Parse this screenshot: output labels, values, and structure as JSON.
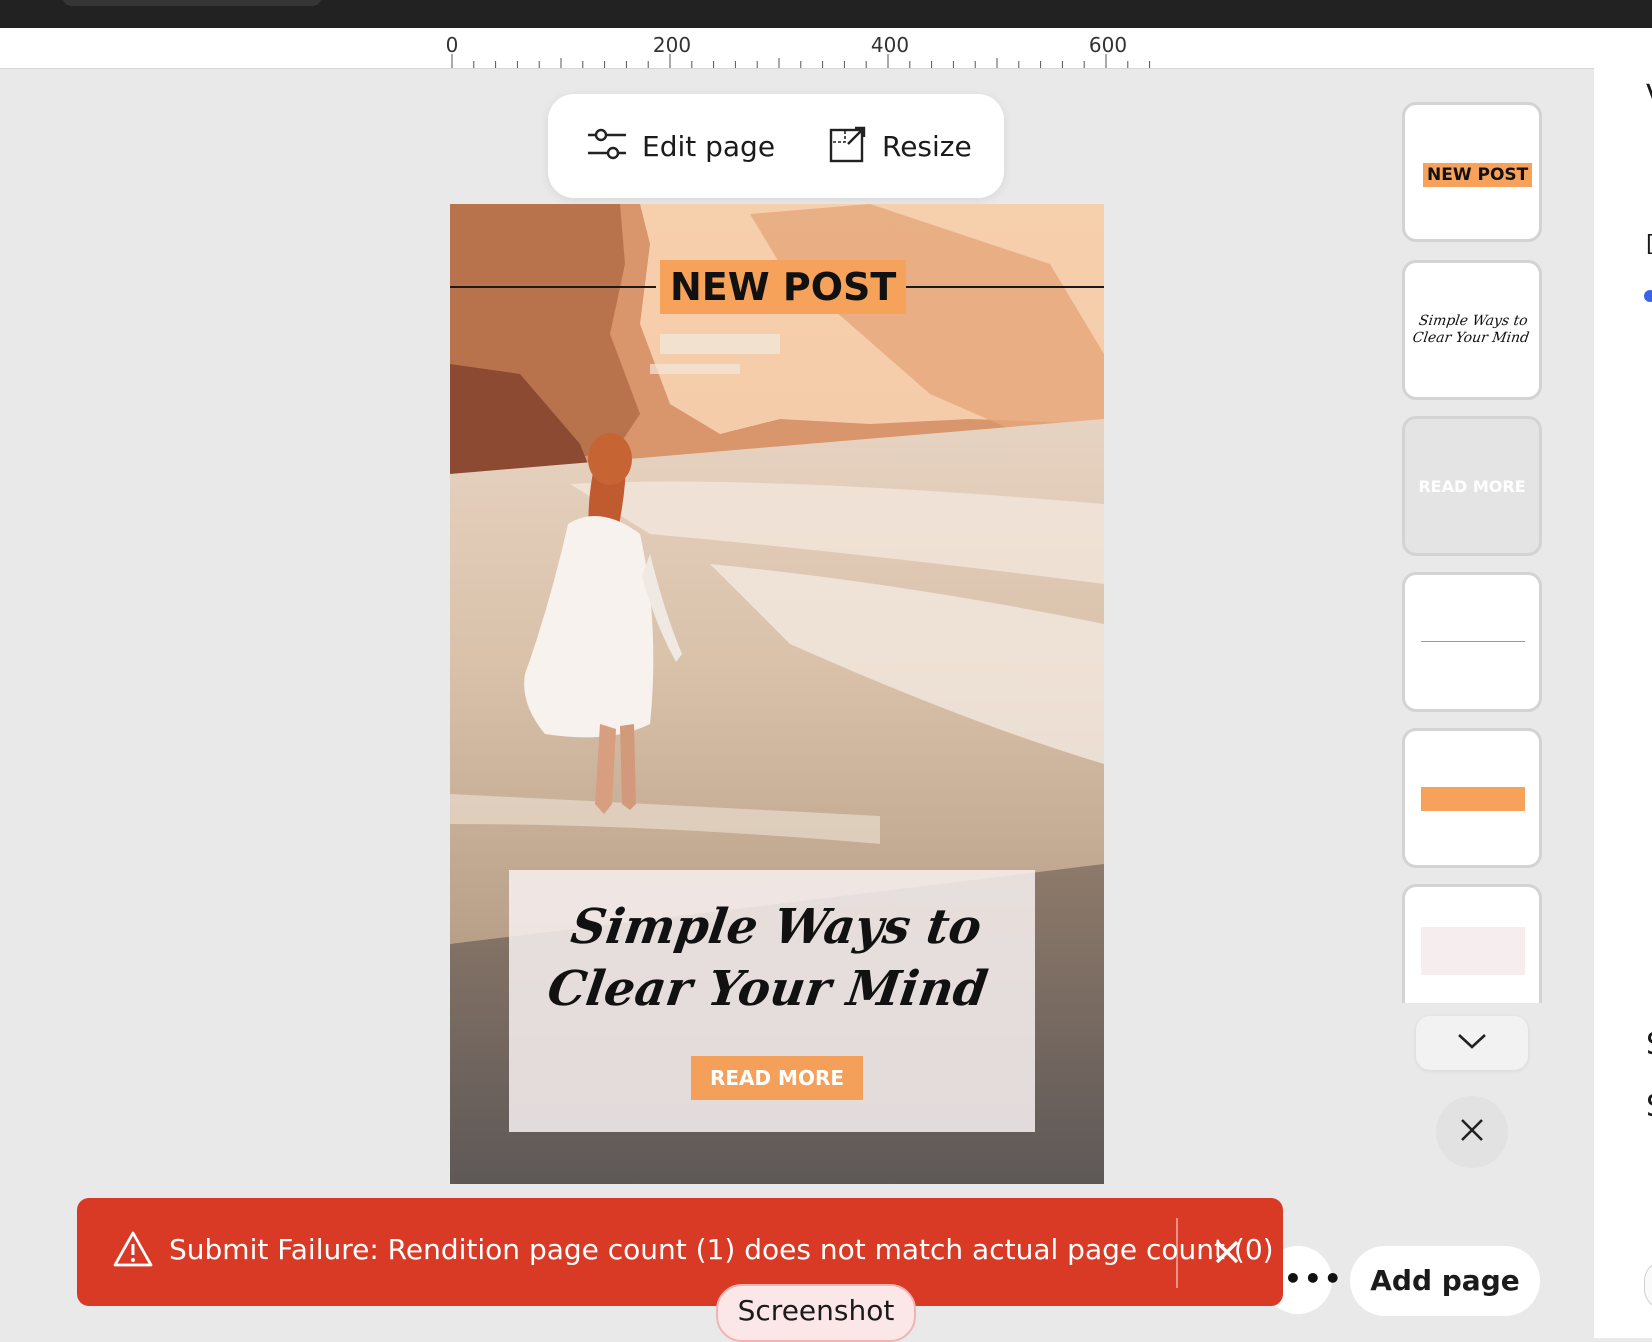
{
  "ruler": {
    "ticks": [
      "0",
      "200",
      "400",
      "600"
    ]
  },
  "toolbar": {
    "edit_label": "Edit page",
    "resize_label": "Resize"
  },
  "design": {
    "new_post": "NEW POST",
    "title_line1": "Simple Ways to",
    "title_line2": "Clear Your Mind",
    "read_more": "READ MORE"
  },
  "thumbnails": {
    "items": [
      {
        "text": "NEW POST"
      },
      {
        "text_line1": "Simple Ways to",
        "text_line2": "Clear Your Mind"
      },
      {
        "text": "READ MORE"
      },
      {
        "text": ""
      },
      {
        "text": ""
      },
      {
        "text": ""
      }
    ]
  },
  "actions": {
    "more_label": "•••",
    "add_page_label": "Add page"
  },
  "toast": {
    "message": "Submit Failure: Rendition page count (1) does not match actual page count (0)"
  },
  "overlay": {
    "screenshot_label": "Screenshot"
  },
  "colors": {
    "accent_orange": "#f6a25a",
    "toast_red": "#d93a26",
    "topbar": "#222222"
  }
}
